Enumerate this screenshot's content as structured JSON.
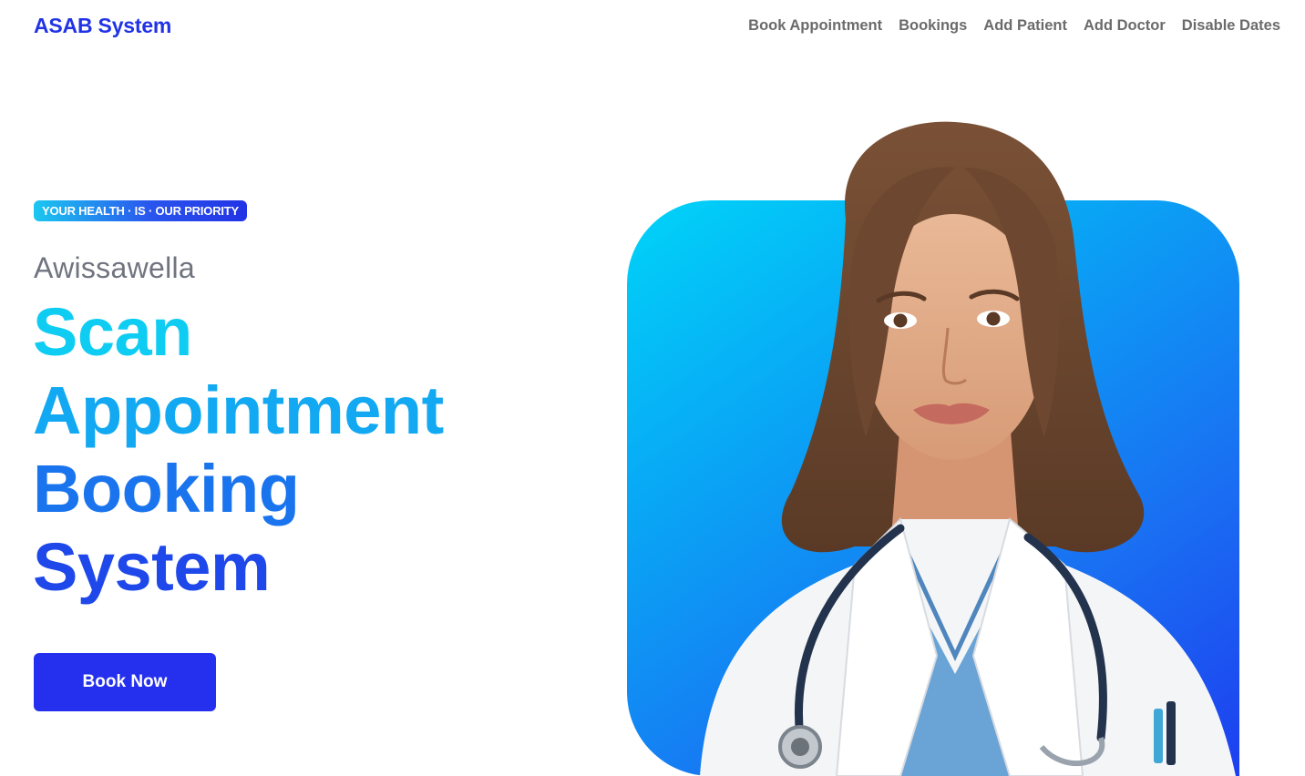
{
  "nav": {
    "brand": "ASAB System",
    "links": [
      "Book Appointment",
      "Bookings",
      "Add Patient",
      "Add Doctor",
      "Disable Dates"
    ]
  },
  "hero": {
    "badge": "YOUR HEALTH · IS · OUR PRIORITY",
    "location": "Awissawella",
    "headline": [
      "Scan",
      "Appointment",
      "Booking",
      "System"
    ],
    "cta_label": "Book Now"
  },
  "colors": {
    "brand": "#2233e6",
    "nav_text": "#6b6b6b",
    "cta_bg": "#2430ee",
    "gradient_start": "#00d4f8",
    "gradient_end": "#1d3ff0"
  },
  "image": {
    "icon": "doctor-portrait"
  }
}
